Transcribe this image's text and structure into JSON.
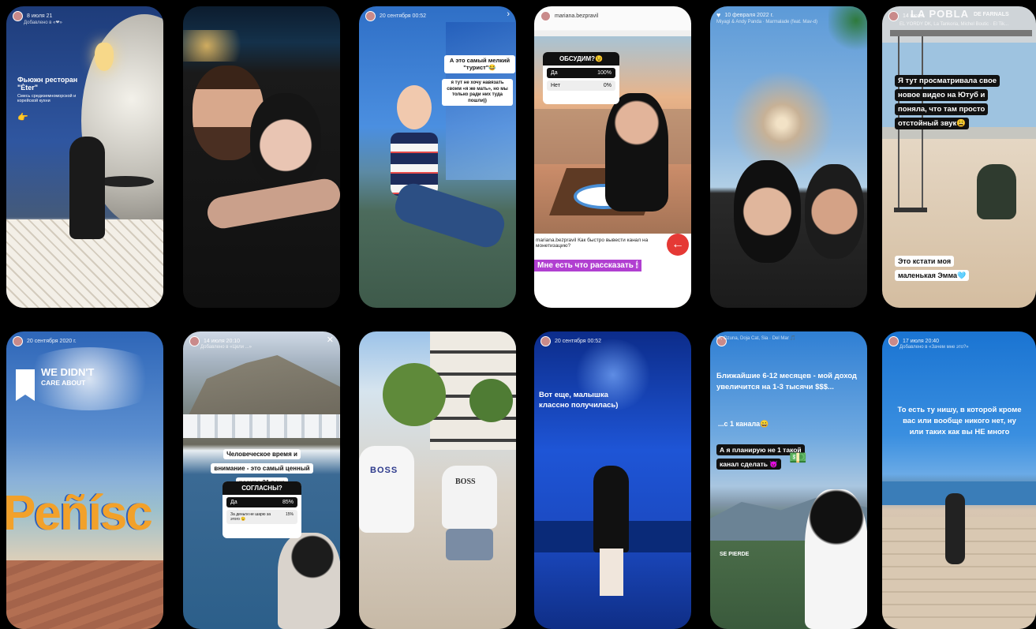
{
  "stories": [
    {
      "header": "8 июля  21",
      "sub": "Добавлено в «❤»",
      "texts": [
        "Фьюжн ресторан \"Ėter\"",
        "Смесь средиземноморской и корейской кухни",
        "👉"
      ]
    },
    {
      "header": "",
      "sub": "",
      "texts": []
    },
    {
      "header": "20 сентября  00:52",
      "sub": "",
      "texts": [
        "А это самый мелкий \"турист\"😂",
        "я тут не хочу навязать своим «я же мать», но мы только ради них туда пошли))"
      ]
    },
    {
      "header": "mariana.bezpravil",
      "sub": "",
      "texts": [
        "ОБСУДИМ?😉",
        "Да",
        "100%",
        "Нет",
        "0%",
        "mariana.bezpravil Как быстро вывести канал на монетизацию?",
        "Мне есть что рассказать 🕯"
      ]
    },
    {
      "header": "10 февраля 2022 г.",
      "sub": "Miyagi & Andy Panda · Marmalade (feat. Mav-d)",
      "texts": []
    },
    {
      "header": "14 июля",
      "sub": "EL YORDY DK, La Tankoria, Michel Boutic · El Tik...",
      "texts": [
        "LA POBLA",
        "DE FARNALS",
        "Я тут просматривала свое новое видео на Ютуб и поняла, что там просто отстойный звук😩",
        "Это кстати моя маленькая Эмма🩵"
      ]
    },
    {
      "header": "20 сентября 2020 г.",
      "sub": "",
      "texts": [
        "WE DIDN'T",
        "CARE ABOUT",
        "Peñísc"
      ]
    },
    {
      "header": "14 июля  20:10",
      "sub": "Добавлено в «Цели ...»",
      "texts": [
        "Человеческое время и внимание - это самый ценный ресурс 21 века",
        "СОГЛАСНЫ?",
        "Да",
        "85%",
        "За деньги не шарю за этого 😉",
        "15%"
      ]
    },
    {
      "header": "",
      "sub": "",
      "texts": [
        "BOSS",
        "BOSS"
      ]
    },
    {
      "header": "20 сентября  00:52",
      "sub": "",
      "texts": [
        "Вот еще, малышка классно получилась)"
      ]
    },
    {
      "header": "",
      "sub": "Hi, Ozuna, Doja Cat, Sia · Del Mar 🎵",
      "texts": [
        "Ближайшие 6-12 месяцев - мой доход увеличится на 1-3 тысячи $$$...",
        "...с 1 канала😄",
        "А я планирую не 1 такой канал сделать 😈",
        "💵",
        "SE PIERDE"
      ]
    },
    {
      "header": "17 июля  20:40",
      "sub": "Добавлено в «Зачем мне это?»",
      "texts": [
        "То есть ту нишу, в которой кроме вас или вообще никого нет, ну или таких как вы НЕ много"
      ]
    }
  ],
  "colors": {
    "background": "#000000",
    "accent_purple": "#b13fd1",
    "accent_red": "#e53935"
  }
}
